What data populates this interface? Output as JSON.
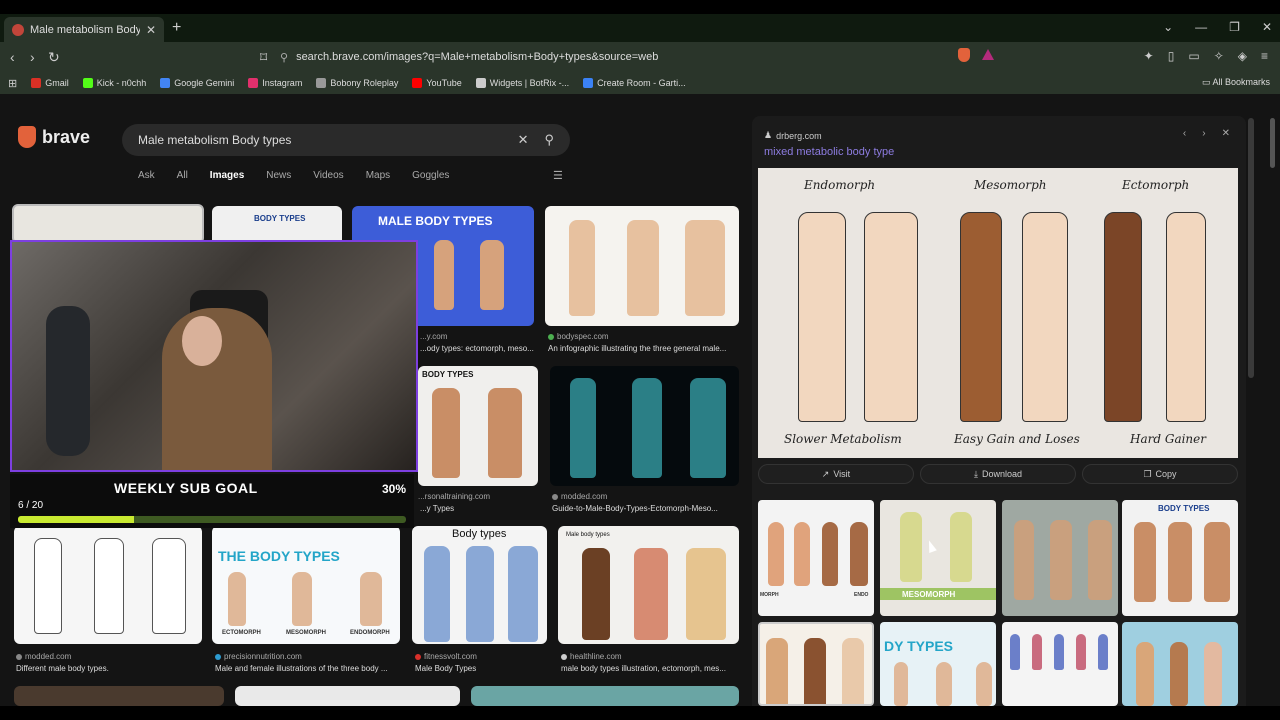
{
  "browser": {
    "tab_title": "Male metabolism Body types - B",
    "new_tab": "+",
    "url": "search.brave.com/images?q=Male+metabolism+Body+types&source=web",
    "all_bookmarks": "All Bookmarks",
    "bookmarks": [
      {
        "label": "Gmail",
        "color": "#d93025"
      },
      {
        "label": "Kick - n0chh",
        "color": "#53fc18"
      },
      {
        "label": "Google Gemini",
        "color": "#4285f4"
      },
      {
        "label": "Instagram",
        "color": "#e1306c"
      },
      {
        "label": "Bobony Roleplay",
        "color": "#999999"
      },
      {
        "label": "YouTube",
        "color": "#ff0000"
      },
      {
        "label": "Widgets | BotRix -...",
        "color": "#cccccc"
      },
      {
        "label": "Create Room - Garti...",
        "color": "#3b82f6"
      }
    ]
  },
  "search": {
    "logo": "brave",
    "query": "Male metabolism Body types",
    "tabs": [
      "Ask",
      "All",
      "Images",
      "News",
      "Videos",
      "Maps",
      "Goggles"
    ],
    "active_tab": "Images"
  },
  "results": [
    {
      "site": "...y.com",
      "title": "...ody types: ectomorph, meso..."
    },
    {
      "site": "bodyspec.com",
      "title": "An infographic illustrating the three general male..."
    },
    {
      "site": "...rsonaltraining.com",
      "title": "...y Types"
    },
    {
      "site": "modded.com",
      "title": "Guide-to-Male-Body-Types-Ectomorph-Meso..."
    },
    {
      "site": "modded.com",
      "title": "Different male body types."
    },
    {
      "site": "precisionnutrition.com",
      "title": "Male and female illustrations of the three body ..."
    },
    {
      "site": "fitnessvolt.com",
      "title": "Male Body Types"
    },
    {
      "site": "healthline.com",
      "title": "male body types illustration, ectomorph, mes..."
    }
  ],
  "thumb_labels": {
    "male_body_types": "MALE BODY TYPES",
    "body_types_small": "BODY TYPES",
    "body_types": "Body types",
    "the_body_types": "THE BODY TYPES",
    "male_body_types_small": "Male body types",
    "mesomorph": "MESOMORPH",
    "endomorph": "ENDOMORPH",
    "ectomorph": "ECTOMORPH"
  },
  "overlay": {
    "goal_title": "WEEKLY SUB GOAL",
    "goal_percent_label": "30%",
    "goal_count": "6 / 20",
    "goal_fraction": 0.3
  },
  "preview": {
    "site": "drberg.com",
    "title": "mixed metabolic body type",
    "labels_top": [
      "Endomorph",
      "Mesomorph",
      "Ectomorph"
    ],
    "labels_bottom": [
      "Slower Metabolism",
      "Easy Gain and Loses",
      "Hard Gainer"
    ],
    "actions": [
      "Visit",
      "Download",
      "Copy"
    ],
    "related_labels": [
      "MESOMORPH",
      "BODY TYPES",
      "DY TYPES",
      "MORPH",
      "ENDO"
    ]
  }
}
